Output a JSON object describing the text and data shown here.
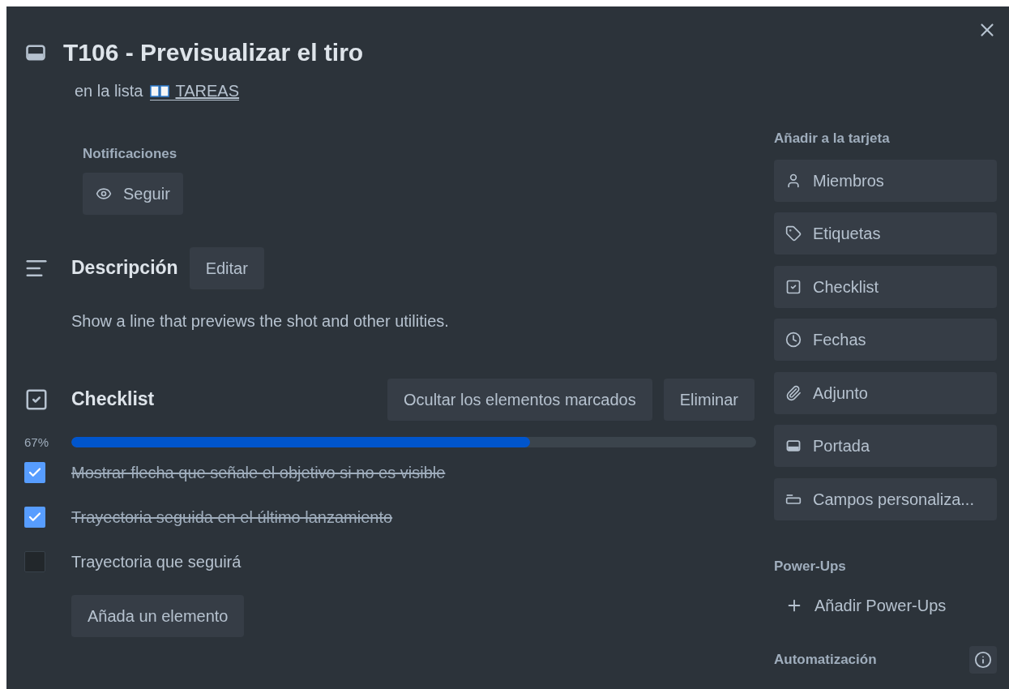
{
  "card": {
    "title": "T106 - Previsualizar el tiro",
    "list_prefix": "en la lista",
    "list_link": "TAREAS"
  },
  "notifications": {
    "label": "Notificaciones",
    "button": "Seguir"
  },
  "description": {
    "heading": "Descripción",
    "edit_button": "Editar",
    "text": "Show a line that previews the shot and other utilities."
  },
  "checklist": {
    "heading": "Checklist",
    "hide_button": "Ocultar los elementos marcados",
    "delete_button": "Eliminar",
    "percent": "67%",
    "level": 0.67,
    "items": [
      {
        "text": "Mostrar flecha que señale el objetivo si no es visible",
        "checked": true
      },
      {
        "text": "Trayectoria seguida en el último lanzamiento",
        "checked": true
      },
      {
        "text": "Trayectoria que seguirá",
        "checked": false
      }
    ],
    "add_button": "Añada un elemento"
  },
  "sidebar": {
    "add_heading": "Añadir a la tarjeta",
    "buttons": [
      {
        "label": "Miembros"
      },
      {
        "label": "Etiquetas"
      },
      {
        "label": "Checklist"
      },
      {
        "label": "Fechas"
      },
      {
        "label": "Adjunto"
      },
      {
        "label": "Portada"
      },
      {
        "label": "Campos personaliza..."
      }
    ],
    "powerups_heading": "Power-Ups",
    "powerups_button": "Añadir Power-Ups",
    "automation_heading": "Automatización"
  }
}
